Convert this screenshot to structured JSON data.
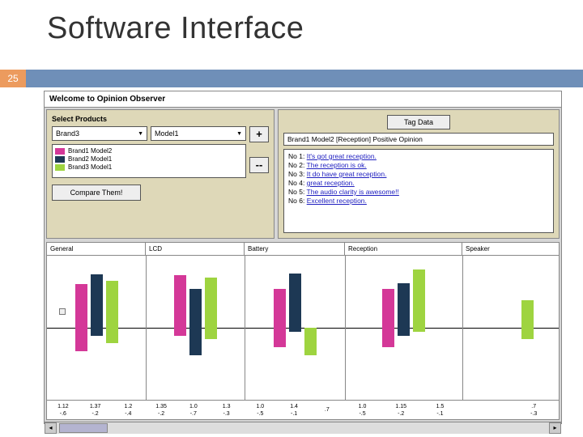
{
  "slide": {
    "title": "Software Interface",
    "page_number": "25"
  },
  "app": {
    "window_title": "Welcome to Opinion Observer",
    "select_label": "Select Products",
    "brand_dropdown": "Brand3",
    "model_dropdown": "Model1",
    "add_btn": "+",
    "remove_btn": "--",
    "compare_btn": "Compare Them!",
    "legend": [
      {
        "label": "Brand1  Model2",
        "color": "#d43898"
      },
      {
        "label": "Brand2  Model1",
        "color": "#1d3854"
      },
      {
        "label": "Brand3  Model1",
        "color": "#9ed440"
      }
    ],
    "tag_btn": "Tag Data",
    "opinion_header": "Brand1 Model2 [Reception] Positive Opinion",
    "opinions": [
      {
        "n": "No 1:",
        "t": "It's got great reception."
      },
      {
        "n": "No 2:",
        "t": "The reception is ok."
      },
      {
        "n": "No 3:",
        "t": "It do have great reception."
      },
      {
        "n": "No 4:",
        "t": "great reception."
      },
      {
        "n": "No 5:",
        "t": "The audio clarity is awesome!!"
      },
      {
        "n": "No 6:",
        "t": "Excellent reception."
      }
    ]
  },
  "chart_data": {
    "type": "bar",
    "facets": [
      "General",
      "LCD",
      "Battery",
      "Reception",
      "Speaker"
    ],
    "series": [
      {
        "name": "Brand1 Model2",
        "color": "#d43898"
      },
      {
        "name": "Brand2 Model1",
        "color": "#1d3854"
      },
      {
        "name": "Brand3 Model1",
        "color": "#9ed440"
      }
    ],
    "values": {
      "General": {
        "pos": [
          1.12,
          1.37,
          1.2
        ],
        "neg": [
          -0.6,
          -0.2,
          -0.4
        ]
      },
      "LCD": {
        "pos": [
          1.35,
          1.0,
          1.3
        ],
        "neg": [
          -0.2,
          -0.7,
          -0.3
        ]
      },
      "Battery": {
        "pos": [
          1.0,
          1.4,
          0.0
        ],
        "neg": [
          -0.5,
          -0.1,
          -0.7
        ]
      },
      "Reception": {
        "pos": [
          1.0,
          1.15,
          1.5
        ],
        "neg": [
          -0.5,
          -0.2,
          -0.1
        ]
      },
      "Speaker": {
        "pos": [
          0.0,
          0.0,
          0.7
        ],
        "neg": [
          0.0,
          0.0,
          -0.3
        ]
      }
    },
    "ticks": [
      {
        "a": "1.12",
        "b": "-.6"
      },
      {
        "a": "1.37",
        "b": "-.2"
      },
      {
        "a": "1.2",
        "b": "-.4"
      },
      {
        "a": "1.35",
        "b": "-.2"
      },
      {
        "a": "1.0",
        "b": "-.7"
      },
      {
        "a": "1.3",
        "b": "-.3"
      },
      {
        "a": "1.0",
        "b": "-.5"
      },
      {
        "a": "1.4",
        "b": "-.1"
      },
      {
        "a": ".7",
        "b": ""
      },
      {
        "a": "1.0",
        "b": "-.5"
      },
      {
        "a": "1.15",
        "b": "-.2"
      },
      {
        "a": "1.5",
        "b": "-.1"
      },
      {
        "a": "",
        "b": ""
      },
      {
        "a": ".7",
        "b": "-.3"
      }
    ],
    "ylim": [
      -1.0,
      1.6
    ]
  }
}
